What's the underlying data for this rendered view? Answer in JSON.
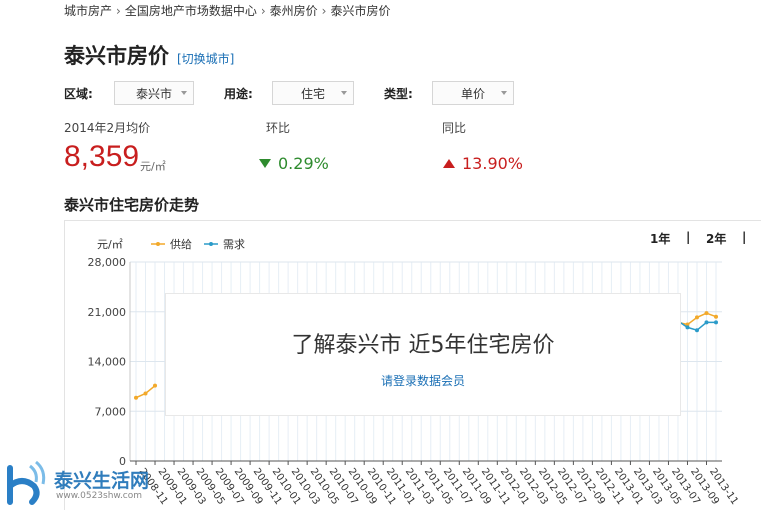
{
  "breadcrumb": [
    "城市房产",
    "全国房地产市场数据中心",
    "泰州房价",
    "泰兴市房价"
  ],
  "page": {
    "title": "泰兴市房价",
    "switch_city": "[切换城市]"
  },
  "filters": [
    {
      "label": "区域:",
      "value": "泰兴市"
    },
    {
      "label": "用途:",
      "value": "住宅"
    },
    {
      "label": "类型:",
      "value": "单价"
    }
  ],
  "stats": {
    "avg_label": "2014年2月均价",
    "avg_value": "8,359",
    "avg_unit": "元/㎡",
    "mom_label": "环比",
    "mom_value": "0.29%",
    "yoy_label": "同比",
    "yoy_value": "13.90%"
  },
  "trend": {
    "title": "泰兴市住宅房价走势",
    "unit": "元/㎡",
    "range_tabs": [
      "1年",
      "|",
      "2年",
      "|"
    ]
  },
  "overlay": {
    "title": "了解泰兴市 近5年住宅房价",
    "link": "请登录数据会员"
  },
  "colors": {
    "supply": "#f2a92b",
    "demand": "#2a9bc9",
    "down": "#2e8b2e",
    "up": "#c81e1e",
    "link": "#1a6fb5"
  },
  "watermark": {
    "text": "泰兴生活网",
    "url": "www.0523shw.com"
  },
  "chart_data": {
    "type": "line",
    "title": "",
    "xlabel": "",
    "ylabel": "元/㎡",
    "ylim": [
      0,
      28000
    ],
    "yticks": [
      "28,000",
      "21,000",
      "14,000",
      "7,000",
      "0"
    ],
    "ytick_values": [
      28000,
      21000,
      14000,
      7000,
      0
    ],
    "xticks": [
      "2008-11",
      "2009-01",
      "2009-03",
      "2009-05",
      "2009-07",
      "2009-09",
      "2009-11",
      "2010-01",
      "2010-03",
      "2010-05",
      "2010-07",
      "2010-09",
      "2010-11",
      "2011-01",
      "2011-03",
      "2011-05",
      "2011-07",
      "2011-09",
      "2011-11",
      "2012-01",
      "2012-03",
      "2012-05",
      "2012-07",
      "2012-09",
      "2012-11",
      "2013-01",
      "2013-03",
      "2013-05",
      "2013-07",
      "2013-09",
      "2013-11"
    ],
    "legend": [
      "供给",
      "需求"
    ],
    "series": [
      {
        "name": "供给",
        "x": [
          "2008-11",
          "2008-12",
          "2009-01"
        ],
        "values": [
          8900,
          9500,
          10600
        ],
        "x2": [
          "2013-08",
          "2013-09",
          "2013-10",
          "2013-11",
          "2013-12"
        ],
        "values2": [
          19500,
          19200,
          20200,
          20800,
          20300
        ]
      },
      {
        "name": "需求",
        "x": [
          "2013-08",
          "2013-09",
          "2013-10",
          "2013-11",
          "2013-12"
        ],
        "values": [
          19700,
          18800,
          18400,
          19500,
          19500
        ]
      }
    ],
    "grid": true,
    "legend_position": "top-left"
  }
}
